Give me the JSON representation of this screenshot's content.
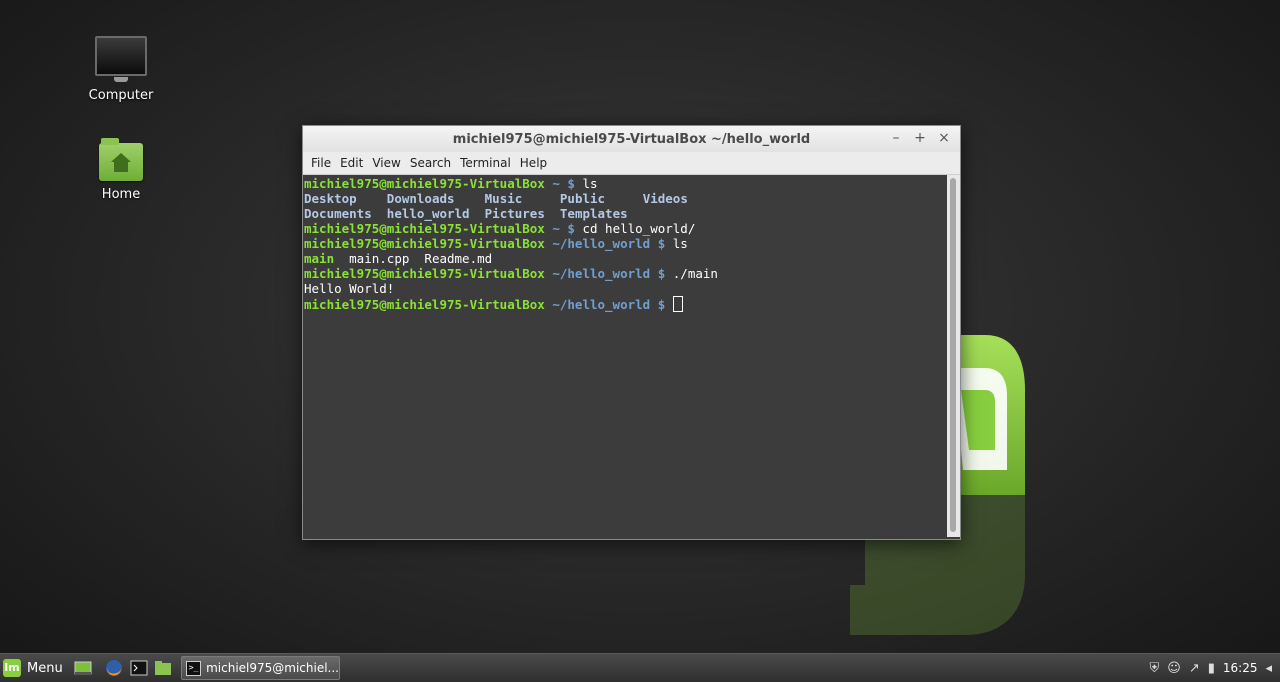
{
  "desktop": {
    "icons": [
      {
        "label": "Computer"
      },
      {
        "label": "Home"
      }
    ]
  },
  "window": {
    "title": "michiel975@michiel975-VirtualBox ~/hello_world",
    "buttons": {
      "minimize": "–",
      "maximize": "+",
      "close": "×"
    },
    "menu": [
      "File",
      "Edit",
      "View",
      "Search",
      "Terminal",
      "Help"
    ]
  },
  "terminal": {
    "lines": [
      {
        "prompt": "michiel975@michiel975-VirtualBox",
        "path": " ~ $ ",
        "cmd": "ls"
      },
      {
        "out_dirs": [
          "Desktop    ",
          "Downloads    ",
          "Music     ",
          "Public     ",
          "Videos"
        ]
      },
      {
        "out_dirs": [
          "Documents  ",
          "hello_world  ",
          "Pictures  ",
          "Templates"
        ]
      },
      {
        "prompt": "michiel975@michiel975-VirtualBox",
        "path": " ~ $ ",
        "cmd": "cd hello_world/"
      },
      {
        "prompt": "michiel975@michiel975-VirtualBox",
        "path": " ~/hello_world $ ",
        "cmd": "ls"
      },
      {
        "out_exec": "main",
        "out_rest": "  main.cpp  Readme.md"
      },
      {
        "prompt": "michiel975@michiel975-VirtualBox",
        "path": " ~/hello_world $ ",
        "cmd": "./main"
      },
      {
        "out": "Hello World!"
      },
      {
        "prompt": "michiel975@michiel975-VirtualBox",
        "path": " ~/hello_world $ ",
        "cmd": ""
      }
    ]
  },
  "panel": {
    "menu_label": "Menu",
    "task_label": "michiel975@michiel...",
    "clock": "16:25",
    "launchers": [
      "show-desktop-icon",
      "firefox-icon",
      "terminal-icon",
      "files-icon"
    ],
    "tray": [
      "shield-icon",
      "user-icon",
      "network-icon",
      "battery-icon",
      "volume-icon"
    ]
  },
  "colors": {
    "prompt_green": "#8ae234",
    "dir_blue": "#729fcf",
    "mint_green": "#87cf3e"
  }
}
